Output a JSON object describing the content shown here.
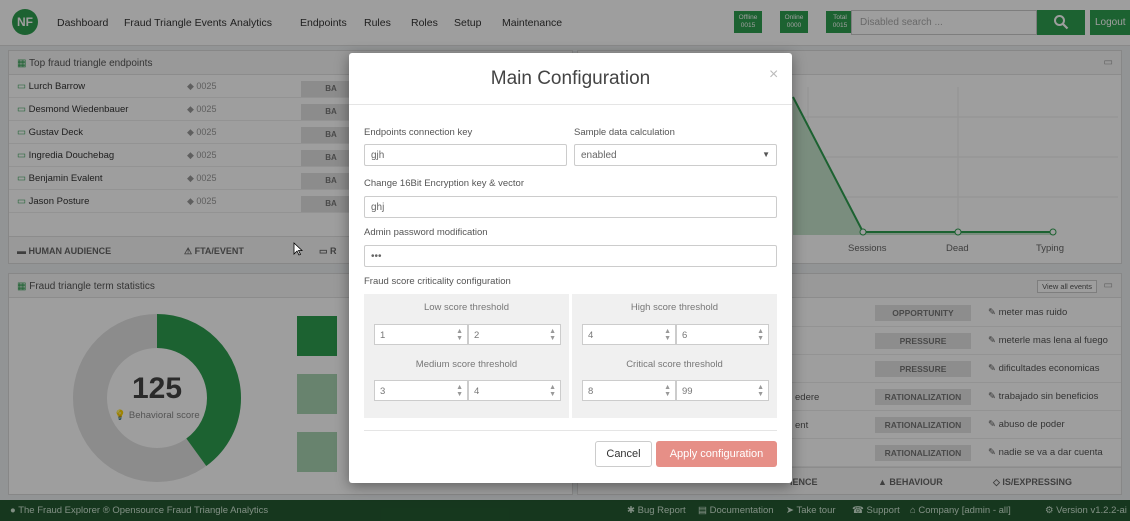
{
  "nav": {
    "logo": "NF",
    "items": [
      "Dashboard",
      "Fraud Triangle Events",
      "Analytics",
      "Endpoints",
      "Rules",
      "Roles",
      "Setup",
      "Maintenance"
    ],
    "badges": [
      {
        "label": "Offline",
        "value": "0015"
      },
      {
        "label": "Online",
        "value": "0000"
      },
      {
        "label": "Total",
        "value": "0015"
      }
    ],
    "search_placeholder": "Disabled search ...",
    "search_icon": "search-icon",
    "logout": "Logout"
  },
  "endpoints_panel": {
    "title": "Top fraud triangle endpoints",
    "rows": [
      {
        "name": "Lurch Barrow",
        "count": "0025"
      },
      {
        "name": "Desmond Wiedenbauer",
        "count": "0025"
      },
      {
        "name": "Gustav Deck",
        "count": "0025"
      },
      {
        "name": "Ingredia Douchebag",
        "count": "0025"
      },
      {
        "name": "Benjamin Evalent",
        "count": "0025"
      },
      {
        "name": "Jason Posture",
        "count": "0025"
      }
    ],
    "ba_label": "BA",
    "footer": [
      "HUMAN AUDIENCE",
      "FTA/EVENT",
      "R"
    ]
  },
  "stats_panel": {
    "title": "Fraud triangle term statistics",
    "score": "125",
    "score_label": "Behavioral score",
    "score_fraction": 0.4
  },
  "chart_panel": {
    "labels": [
      "Sessions",
      "Dead",
      "Typing"
    ]
  },
  "events_panel": {
    "view_all": "View all events",
    "rows": [
      {
        "partial": "",
        "tag": "OPPORTUNITY",
        "text": "meter mas ruido"
      },
      {
        "partial": "",
        "tag": "PRESSURE",
        "text": "meterle mas lena al fuego"
      },
      {
        "partial": "",
        "tag": "PRESSURE",
        "text": "dificultades economicas"
      },
      {
        "partial": "edere",
        "tag": "RATIONALIZATION",
        "text": "trabajado sin beneficios"
      },
      {
        "partial": "ent",
        "tag": "RATIONALIZATION",
        "text": "abuso de poder"
      },
      {
        "partial": "",
        "tag": "RATIONALIZATION",
        "text": "nadie se va a dar cuenta"
      }
    ],
    "footer": [
      "IENCE",
      "BEHAVIOUR",
      "IS/EXPRESSING"
    ]
  },
  "footer": {
    "left": "The Fraud Explorer ® Opensource Fraud Triangle Analytics",
    "links": [
      "Bug Report",
      "Documentation",
      "Take tour",
      "Support",
      "Company [admin - all]",
      "Version v1.2.2-ai"
    ]
  },
  "modal": {
    "title": "Main Configuration",
    "close": "×",
    "endpoints_key_label": "Endpoints connection key",
    "endpoints_key_value": "gjh",
    "sample_label": "Sample data calculation",
    "sample_value": "enabled",
    "encryption_label": "Change 16Bit Encryption key & vector",
    "encryption_value": "ghj",
    "admin_label": "Admin password modification",
    "admin_value": "•••",
    "criticality_label": "Fraud score criticality configuration",
    "low_title": "Low score threshold",
    "low_min": "1",
    "low_max": "2",
    "high_title": "High score threshold",
    "high_min": "4",
    "high_max": "6",
    "medium_title": "Medium score threshold",
    "medium_min": "3",
    "medium_max": "4",
    "critical_title": "Critical score threshold",
    "critical_min": "8",
    "critical_max": "99",
    "cancel": "Cancel",
    "apply": "Apply configuration"
  }
}
